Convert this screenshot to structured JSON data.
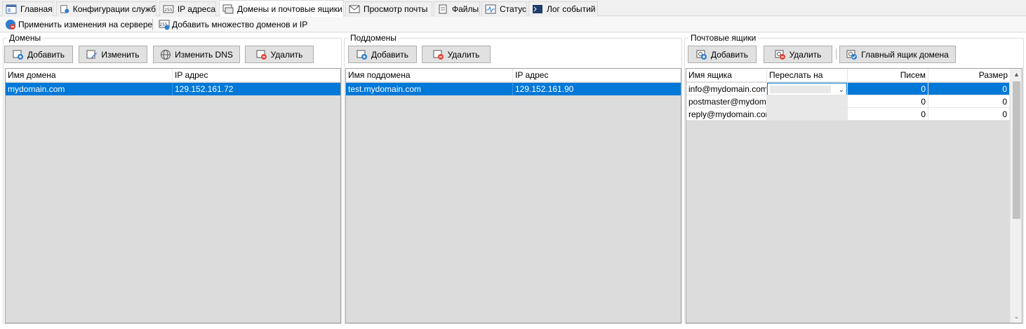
{
  "tabs": [
    {
      "label": "Главная",
      "icon": "home-window-icon"
    },
    {
      "label": "Конфигурации служб",
      "icon": "services-config-icon"
    },
    {
      "label": "IP адреса",
      "icon": "ip-address-icon"
    },
    {
      "label": "Домены и почтовые ящики",
      "icon": "domains-mailboxes-icon",
      "active": true
    },
    {
      "label": "Просмотр почты",
      "icon": "envelope-icon"
    },
    {
      "label": "Файлы",
      "icon": "files-icon"
    },
    {
      "label": "Статус",
      "icon": "status-pulse-icon"
    },
    {
      "label": "Лог событий",
      "icon": "event-log-icon"
    }
  ],
  "toolbar": {
    "apply_label": "Применить изменения на сервере",
    "add_many_label": "Добавить множество доменов и IP"
  },
  "domains": {
    "title": "Домены",
    "buttons": {
      "add": "Добавить",
      "edit": "Изменить",
      "edit_dns": "Изменить DNS",
      "delete": "Удалить"
    },
    "columns": [
      "Имя домена",
      "IP адрес"
    ],
    "rows": [
      {
        "name": "mydomain.com",
        "ip": "129.152.161.72",
        "selected": true
      }
    ]
  },
  "subdomains": {
    "title": "Поддомены",
    "buttons": {
      "add": "Добавить",
      "delete": "Удалить"
    },
    "columns": [
      "Имя поддомена",
      "IP адрес"
    ],
    "rows": [
      {
        "name": "test.mydomain.com",
        "ip": "129.152.161.90",
        "selected": true
      }
    ]
  },
  "mailboxes": {
    "title": "Почтовые ящики",
    "buttons": {
      "add": "Добавить",
      "delete": "Удалить",
      "main_box": "Главный ящик домена"
    },
    "columns": [
      "Имя ящика",
      "Переслать на",
      "Писем",
      "Размер"
    ],
    "rows": [
      {
        "name": "info@mydomain.com",
        "forward": "",
        "letters": "0",
        "size": "0"
      },
      {
        "name": "postmaster@mydomain.com",
        "forward": "",
        "letters": "0",
        "size": "0"
      },
      {
        "name": "reply@mydomain.com",
        "forward": "",
        "letters": "0",
        "size": "0"
      }
    ]
  },
  "colors": {
    "selection": "#0078d7",
    "grid_bg": "#dcdcdc"
  }
}
